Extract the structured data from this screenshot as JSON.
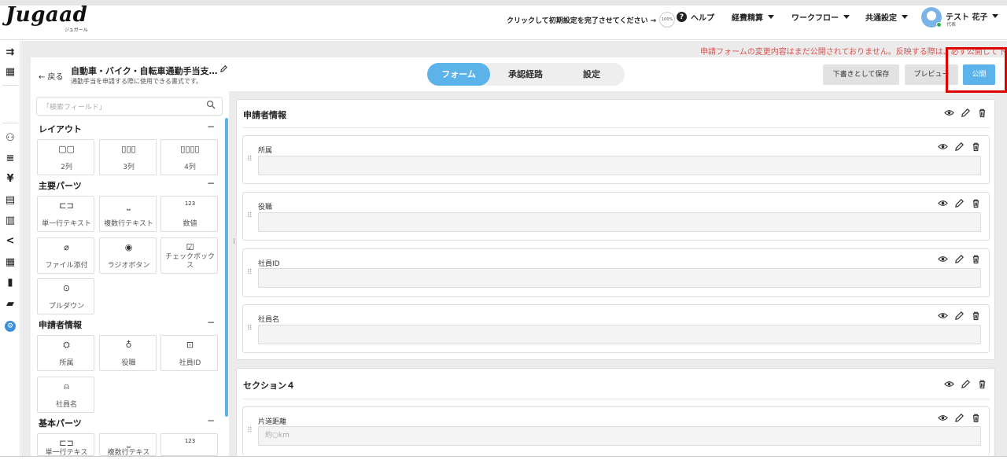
{
  "header": {
    "logo": "Jugaad",
    "logo_sub": "ジュガール",
    "setup_text": "クリックして初期設定を完了させてください →",
    "setup_pct": "100%",
    "help": "ヘルプ",
    "menus": [
      "経費精算",
      "ワークフロー",
      "共通設定"
    ],
    "user_name": "テスト 花子",
    "user_role": "代表"
  },
  "notice": "申請フォームの変更内容はまだ公開されておりません。反映する際は、必ず公開して下さい。",
  "form_header": {
    "back": "← 戻る",
    "title": "自動車・バイク・自転車通勤手当支…",
    "subtitle": "通勤手当を申請する際に使用できる書式です。",
    "tabs": [
      "フォーム",
      "承認経路",
      "設定"
    ],
    "save_draft": "下書きとして保存",
    "preview": "プレビュー",
    "publish": "公開"
  },
  "palette": {
    "search_placeholder": "「検索フィールド」",
    "sections": [
      {
        "title": "レイアウト",
        "items": [
          {
            "icon": "two-column-icon",
            "glyph": "▢▢",
            "label": "2列"
          },
          {
            "icon": "three-column-icon",
            "glyph": "▯▯▯",
            "label": "3列"
          },
          {
            "icon": "four-column-icon",
            "glyph": "▯▯▯▯",
            "label": "4列"
          }
        ]
      },
      {
        "title": "主要パーツ",
        "items": [
          {
            "icon": "single-line-text-icon",
            "glyph": "⊏⊐",
            "label": "単一行テキスト"
          },
          {
            "icon": "multi-line-text-icon",
            "glyph": "⎵",
            "label": "複数行テキスト"
          },
          {
            "icon": "number-icon",
            "glyph": "123",
            "label": "数値"
          },
          {
            "icon": "paperclip-icon",
            "glyph": "⌀",
            "label": "ファイル添付"
          },
          {
            "icon": "radio-button-icon",
            "glyph": "◉",
            "label": "ラジオボタン"
          },
          {
            "icon": "checkbox-icon",
            "glyph": "☑",
            "label": "チェックボックス"
          },
          {
            "icon": "dropdown-icon",
            "glyph": "⊙",
            "label": "プルダウン"
          }
        ]
      },
      {
        "title": "申請者情報",
        "items": [
          {
            "icon": "department-icon",
            "glyph": "⛭",
            "label": "所属"
          },
          {
            "icon": "position-icon",
            "glyph": "♁",
            "label": "役職"
          },
          {
            "icon": "employee-id-icon",
            "glyph": "⊡",
            "label": "社員ID"
          },
          {
            "icon": "employee-name-icon",
            "glyph": "⍝",
            "label": "社員名"
          }
        ]
      },
      {
        "title": "基本パーツ",
        "items": [
          {
            "icon": "single-line-text-icon",
            "glyph": "⊏⊐",
            "label": "単一行テキス"
          },
          {
            "icon": "multi-line-text-icon",
            "glyph": "⎵",
            "label": "複数行テキス"
          },
          {
            "icon": "number-icon",
            "glyph": "123",
            "label": ""
          }
        ]
      }
    ]
  },
  "form": {
    "sections": [
      {
        "title": "申請者情報",
        "fields": [
          {
            "label": "所属",
            "placeholder": ""
          },
          {
            "label": "役職",
            "placeholder": ""
          },
          {
            "label": "社員ID",
            "placeholder": ""
          },
          {
            "label": "社員名",
            "placeholder": ""
          }
        ]
      },
      {
        "title": "セクション４",
        "fields": [
          {
            "label": "片道距離",
            "placeholder": "約○km"
          }
        ]
      }
    ]
  },
  "colors": {
    "accent": "#5cb3ea",
    "notice": "#d9534f",
    "highlight": "#e00000"
  }
}
